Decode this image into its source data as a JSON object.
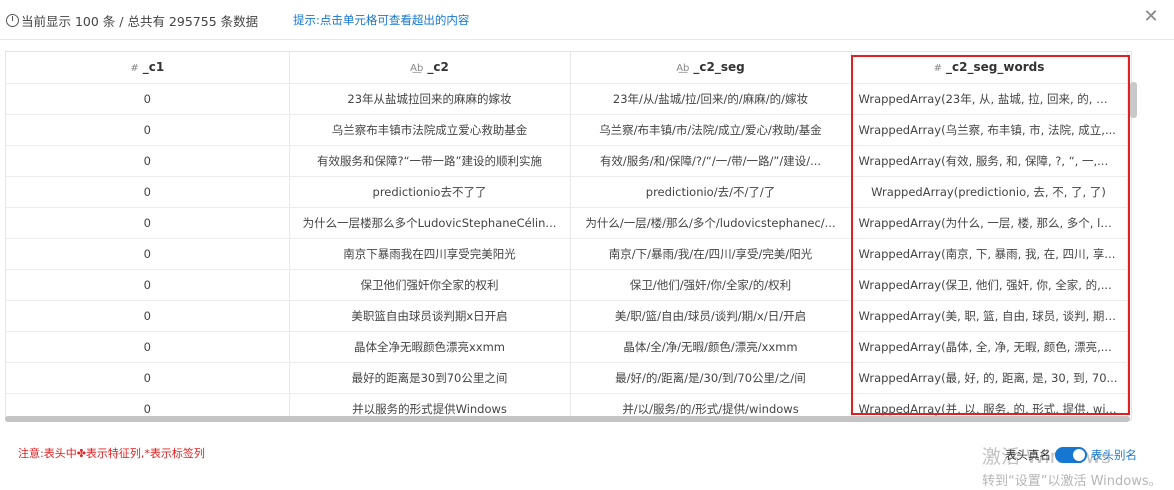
{
  "topbar": {
    "info": "当前显示 100 条 / 总共有 295755 条数据",
    "hint": "提示:点击单元格可查看超出的内容",
    "close": "✕"
  },
  "table": {
    "columns": [
      {
        "type": "#",
        "name": "_c1"
      },
      {
        "type": "A͟b",
        "name": "_c2"
      },
      {
        "type": "A͟b",
        "name": "_c2_seg"
      },
      {
        "type": "#",
        "name": "_c2_seg_words"
      }
    ],
    "rows": [
      [
        "0",
        "23年从盐城拉回来的麻麻的嫁妆",
        "23年/从/盐城/拉/回来/的/麻麻/的/嫁妆",
        "WrappedArray(23年, 从, 盐城, 拉, 回来, 的, 麻..."
      ],
      [
        "0",
        "乌兰察布丰镇市法院成立爱心救助基金",
        "乌兰察/布丰镇/市/法院/成立/爱心/救助/基金",
        "WrappedArray(乌兰察, 布丰镇, 市, 法院, 成立,..."
      ],
      [
        "0",
        "有效服务和保障?“一带一路”建设的顺利实施",
        "有效/服务/和/保障/?/“/一/带/一路/”/建设/...",
        "WrappedArray(有效, 服务, 和, 保障, ?, “, 一,..."
      ],
      [
        "0",
        "predictionio去不了了",
        "predictionio/去/不/了/了",
        "WrappedArray(predictionio, 去, 不, 了, 了)"
      ],
      [
        "0",
        "为什么一层楼那么多个LudovicStephaneCélin...",
        "为什么/一层/楼/那么/多个/ludovicstephanec/...",
        "WrappedArray(为什么, 一层, 楼, 那么, 多个, lu..."
      ],
      [
        "0",
        "南京下暴雨我在四川享受完美阳光",
        "南京/下/暴雨/我/在/四川/享受/完美/阳光",
        "WrappedArray(南京, 下, 暴雨, 我, 在, 四川, 享..."
      ],
      [
        "0",
        "保卫他们强奸你全家的权利",
        "保卫/他们/强奸/你/全家/的/权利",
        "WrappedArray(保卫, 他们, 强奸, 你, 全家, 的,..."
      ],
      [
        "0",
        "美职篮自由球员谈判期x日开启",
        "美/职/篮/自由/球员/谈判/期/x/日/开启",
        "WrappedArray(美, 职, 篮, 自由, 球员, 谈判, 期,..."
      ],
      [
        "0",
        "晶体全净无暇颜色漂亮xxmm",
        "晶体/全/净/无暇/颜色/漂亮/xxmm",
        "WrappedArray(晶体, 全, 净, 无暇, 颜色, 漂亮,..."
      ],
      [
        "0",
        "最好的距离是30到70公里之间",
        "最/好/的/距离/是/30/到/70公里/之/间",
        "WrappedArray(最, 好, 的, 距离, 是, 30, 到, 70..."
      ],
      [
        "0",
        "并以服务的形式提供Windows",
        "并/以/服务/的/形式/提供/windows",
        "WrappedArray(并, 以, 服务, 的, 形式, 提供, wi..."
      ]
    ]
  },
  "footer": {
    "note": "注意:表头中✤表示特征列,*表示标签列",
    "toggle_left": "表头真名",
    "toggle_right": "表头别名",
    "toggle_on": true
  },
  "watermark": {
    "line1": "激活 Windows",
    "line2": "转到“设置”以激活 Windows。"
  },
  "colors": {
    "accent": "#1677d2",
    "highlight": "#e02020"
  }
}
